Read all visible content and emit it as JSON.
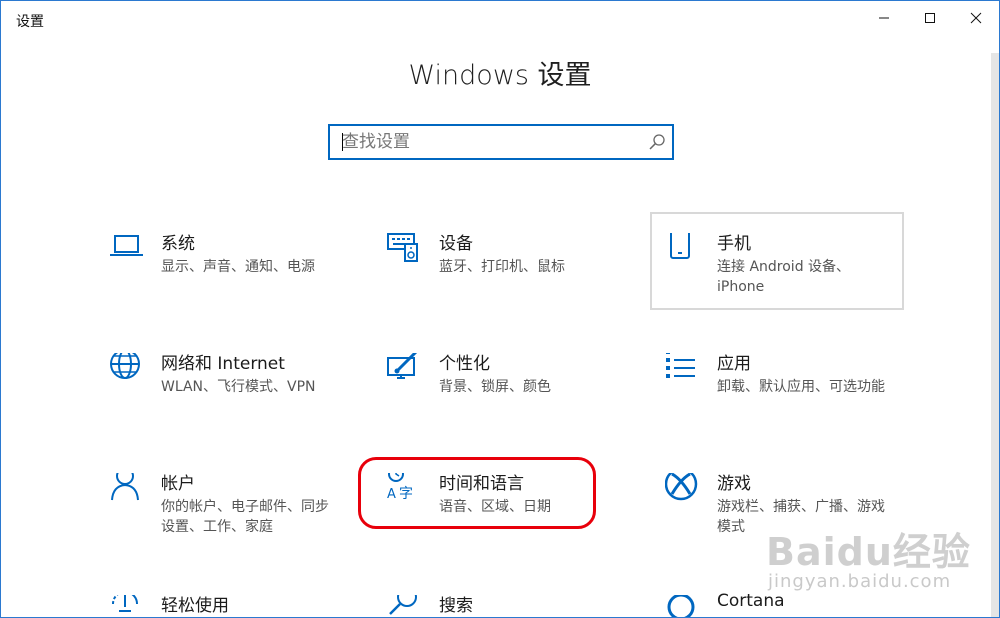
{
  "window": {
    "title": "设置",
    "controls": {
      "minimize": "minimize-icon",
      "maximize": "maximize-icon",
      "close": "close-icon"
    }
  },
  "heading": "Windows 设置",
  "search": {
    "placeholder": "查找设置",
    "icon": "search-icon"
  },
  "categories": [
    {
      "title": "系统",
      "desc": "显示、声音、通知、电源",
      "icon": "laptop-icon"
    },
    {
      "title": "设备",
      "desc": "蓝牙、打印机、鼠标",
      "icon": "keyboard-speaker-icon"
    },
    {
      "title": "手机",
      "desc": "连接 Android 设备、iPhone",
      "icon": "phone-icon"
    },
    {
      "title": "网络和 Internet",
      "desc": "WLAN、飞行模式、VPN",
      "icon": "globe-icon"
    },
    {
      "title": "个性化",
      "desc": "背景、锁屏、颜色",
      "icon": "paint-brush-icon"
    },
    {
      "title": "应用",
      "desc": "卸载、默认应用、可选功能",
      "icon": "apps-list-icon"
    },
    {
      "title": "帐户",
      "desc": "你的帐户、电子邮件、同步设置、工作、家庭",
      "icon": "person-icon"
    },
    {
      "title": "时间和语言",
      "desc": "语音、区域、日期",
      "icon": "time-language-icon"
    },
    {
      "title": "游戏",
      "desc": "游戏栏、捕获、广播、游戏模式",
      "icon": "xbox-icon"
    },
    {
      "title": "轻松使用",
      "desc": "",
      "icon": "ease-of-access-icon"
    },
    {
      "title": "搜索",
      "desc": "",
      "icon": "search-magnifier-icon"
    },
    {
      "title": "Cortana",
      "desc": "",
      "icon": "cortana-circle-icon"
    }
  ],
  "watermark": {
    "main": "Baidu经验",
    "sub": "jingyan.baidu.com"
  },
  "accent_color": "#0067c0",
  "highlight_color": "#e8000b"
}
